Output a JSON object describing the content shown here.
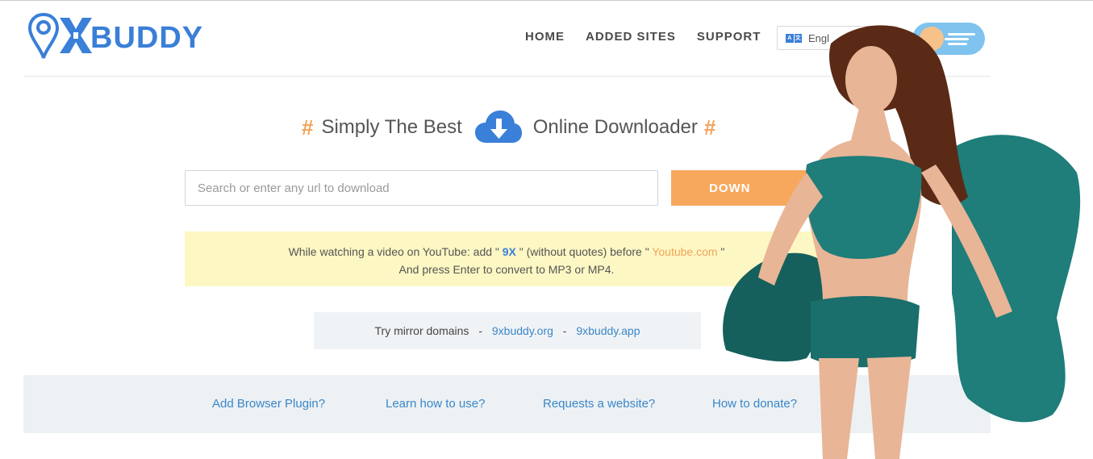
{
  "brand": {
    "logo_text": "BUDDY",
    "logo_lettering": "9XBUDDY",
    "primary_color": "#3a7fd8",
    "accent_color": "#f7a85d"
  },
  "nav": {
    "home": "HOME",
    "added_sites": "ADDED SITES",
    "support": "SUPPORT"
  },
  "language": {
    "selected": "Engl",
    "icon_left": "A",
    "icon_right": "文"
  },
  "headline": {
    "hash_left": "#",
    "text_before_icon": "Simply The Best",
    "icon": "cloud-download-icon",
    "text_after_icon": "Online Downloader",
    "hash_right": "#"
  },
  "search": {
    "placeholder": "Search or enter any url to download",
    "button_label": "DOWN"
  },
  "tip": {
    "part1": "While watching a video on YouTube: add \" ",
    "highlight": "9X",
    "part2": " \" (without quotes) before \" ",
    "site": "Youtube.com",
    "part3": " \"",
    "line2": "And press Enter to convert to MP3 or MP4."
  },
  "mirrors": {
    "label": "Try mirror domains",
    "dash1": "-",
    "domain1": "9xbuddy.org",
    "dash2": "-",
    "domain2": "9xbuddy.app"
  },
  "footer_links": {
    "plugin": "Add Browser Plugin?",
    "learn": "Learn how to use?",
    "request": "Requests a website?",
    "donate": "How to donate?"
  }
}
